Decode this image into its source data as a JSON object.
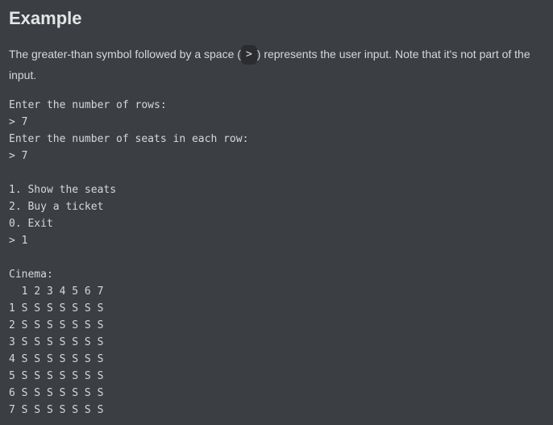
{
  "heading": "Example",
  "intro": {
    "before": "The greater-than symbol followed by a space (",
    "code": "> ",
    "after": ") represents the user input. Note that it's not part of the input."
  },
  "console_lines": [
    "Enter the number of rows:",
    "> 7",
    "Enter the number of seats in each row:",
    "> 7",
    "",
    "1. Show the seats",
    "2. Buy a ticket",
    "0. Exit",
    "> 1",
    "",
    "Cinema:",
    "  1 2 3 4 5 6 7",
    "1 S S S S S S S",
    "2 S S S S S S S",
    "3 S S S S S S S",
    "4 S S S S S S S",
    "5 S S S S S S S",
    "6 S S S S S S S",
    "7 S S S S S S S"
  ]
}
